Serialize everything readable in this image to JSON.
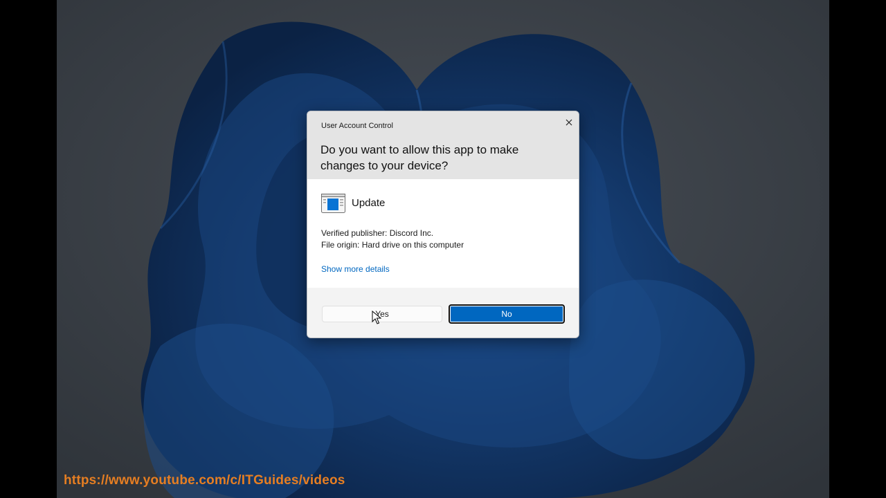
{
  "dialog": {
    "title": "User Account Control",
    "question": "Do you want to allow this app to make changes to your device?",
    "app_name": "Update",
    "publisher": "Verified publisher: Discord Inc.",
    "origin": "File origin: Hard drive on this computer",
    "details_link": "Show more details",
    "yes_label": "Yes",
    "no_label": "No",
    "close_icon": "close-icon",
    "app_icon": "app-window-icon"
  },
  "watermark": "https://www.youtube.com/c/ITGuides/videos",
  "colors": {
    "accent": "#0067c0",
    "watermark": "#e67e22",
    "desktop": "#3a4047",
    "bloom": "#14386a"
  }
}
